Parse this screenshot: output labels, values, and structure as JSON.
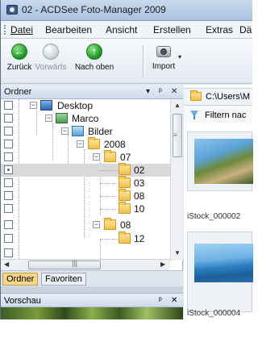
{
  "window": {
    "title": "02 - ACDSee Foto-Manager 2009"
  },
  "menu": [
    {
      "label": "Datei"
    },
    {
      "label": "Bearbeiten"
    },
    {
      "label": "Ansicht"
    },
    {
      "label": "Erstellen"
    },
    {
      "label": "Extras"
    },
    {
      "label": "Dä"
    }
  ],
  "toolbar": {
    "back": "Zurück",
    "forward": "Vorwärts",
    "up": "Nach oben",
    "import": "Import"
  },
  "folder_panel": {
    "title": "Ordner",
    "controls": {
      "dropdown": "▾",
      "pin": "ᵖ",
      "close": "✕"
    },
    "tree": [
      {
        "label": "Desktop",
        "icon": "desktop-icon"
      },
      {
        "label": "Marco",
        "icon": "user-folder-icon"
      },
      {
        "label": "Bilder",
        "icon": "pictures-folder-icon"
      },
      {
        "label": "2008",
        "icon": "folder-icon"
      },
      {
        "label": "07",
        "icon": "folder-icon"
      },
      {
        "label": "02",
        "icon": "folder-icon",
        "selected": true
      },
      {
        "label": "03",
        "icon": "folder-icon"
      },
      {
        "label": "08",
        "icon": "folder-icon"
      },
      {
        "label": "10",
        "icon": "folder-icon"
      },
      {
        "label": "08",
        "icon": "folder-icon"
      },
      {
        "label": "12",
        "icon": "folder-icon"
      }
    ],
    "tabs": {
      "active": "Ordner",
      "inactive": "Favoriten"
    }
  },
  "preview_panel": {
    "title": "Vorschau"
  },
  "browser": {
    "path": "C:\\Users\\M",
    "filter": "Filtern nac",
    "thumbnails": [
      {
        "caption": "iStock_000002"
      },
      {
        "caption": "iStock_000004"
      }
    ]
  },
  "colors": {
    "titlebar": "#a9c1e0",
    "tab_active": "#f5d68a",
    "selection": "#d9d9d9"
  }
}
